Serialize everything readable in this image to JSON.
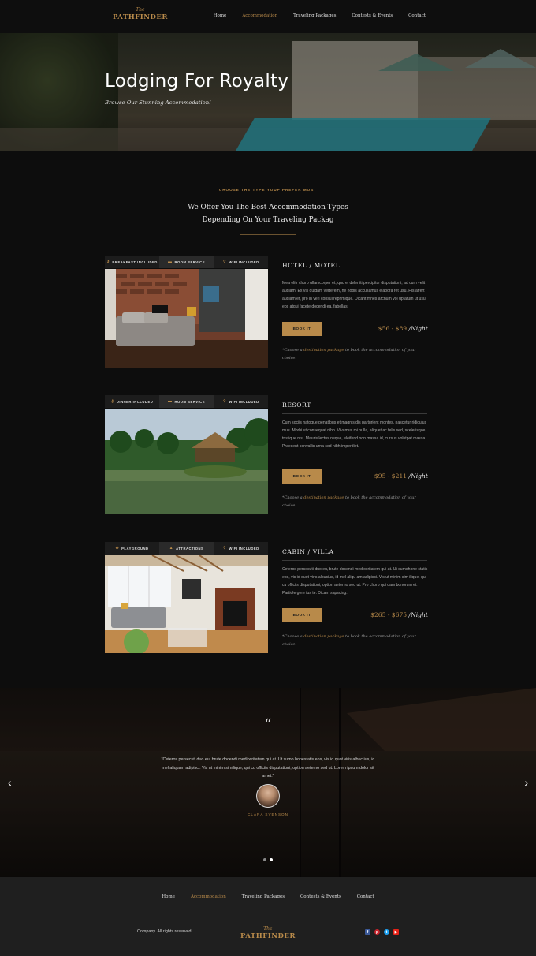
{
  "brand": {
    "the": "The",
    "name": "PATHFINDER"
  },
  "nav": {
    "items": [
      "Home",
      "Accommodation",
      "Traveling Packages",
      "Contests & Events",
      "Contact"
    ],
    "active": "Accommodation"
  },
  "hero": {
    "title": "Lodging For Royalty",
    "subtitle": "Browse Our Stunning Accommodation!"
  },
  "intro": {
    "eyebrow": "CHOOSE THE TYPE YOUP PREFER MOST",
    "title_line1": "We Offer You The Best Accommodation Types",
    "title_line2": "Depending On Your Traveling Packag"
  },
  "accommodations": [
    {
      "tags": [
        {
          "icon": "key-icon",
          "label": "BREAKFAST INCLUDED"
        },
        {
          "icon": "room-service-icon",
          "label": "ROOM SERVICE"
        },
        {
          "icon": "wifi-icon",
          "label": "WIFI INCLUDED"
        }
      ],
      "title": "HOTEL / MOTEL",
      "description": "Mea elitr choro ullamcorper et, quo ei deleniti percipitur disputationi, ad cum velit audiam. Ex vis quidam verterem, ne nobis accusamus elabora ret usu. His affert audiam et, pro in veri consul reprimique. Dicant mnes archum vol uptatum ut usu, eos atqui facete docendi ea, fabellas.",
      "book_label": "BOOK IT",
      "price": "$56 - $89",
      "price_unit": "Night",
      "note_pre": "*Choose a ",
      "note_link": "destination package",
      "note_post": " to book the accommodation of your choice."
    },
    {
      "tags": [
        {
          "icon": "key-icon",
          "label": "DINNER INCLUDED"
        },
        {
          "icon": "room-service-icon",
          "label": "ROOM SERVICE"
        },
        {
          "icon": "wifi-icon",
          "label": "WIFI INCLUDED"
        }
      ],
      "title": "RESORT",
      "description": "Cum sociis natoque penatibus et magnis dis parturient montes, nascetur ridiculus mus. Morbi ut consequat nibh. Vivamus mi nulla, aliquet ac felis sed, scelerisque tristique nisi. Mauris lectus neque, eleifend non massa id, cursus volutpat massa. Praesent convallis urna sed nibh imperdiet.",
      "book_label": "BOOK IT",
      "price": "$95 - $211",
      "price_unit": "Night",
      "note_pre": "*Choose a ",
      "note_link": "destination package",
      "note_post": " to book the accommodation of your choice."
    },
    {
      "tags": [
        {
          "icon": "playground-icon",
          "label": "PLAYGROUND"
        },
        {
          "icon": "attractions-icon",
          "label": "ATTRACTIONS"
        },
        {
          "icon": "wifi-icon",
          "label": "WIFI INCLUDED"
        }
      ],
      "title": "CABIN / VILLA",
      "description": "Ceteros persecuti duo eu, brute docendi mediocritatem qui at. Ut sumohone statis eos, vis id quot viris albucius, id mel aliqu am adipisci. Vis ut minim sim ilique, qui cu officiis disputationi, option aeterno sed ut. Pro choro qui dam bonorum ei. Partiole gere ius te. Dicam sapscing.",
      "book_label": "BOOK IT",
      "price": "$265 - $675",
      "price_unit": "Night",
      "note_pre": "*Choose a ",
      "note_link": "destination package",
      "note_post": " to book the accommodation of your choice."
    }
  ],
  "testimonial": {
    "quote_mark": "“",
    "quote": "\"Ceteros persecuti duo eu, brute docendi mediocritatem qui at. Ut sumo honestatis eos, vis id quot viris albuc ius, id mel aliquam adipisci. Vis ut minim similique, qui cu officiis disputationi, option aeterno sed ut. Lorem ipsum dolor sit amet.\"",
    "author": "CLARA SVENSON",
    "prev_icon": "chevron-left-icon",
    "next_icon": "chevron-right-icon",
    "slides": 2,
    "active_slide": 1
  },
  "footer": {
    "links": [
      "Home",
      "Accommodation",
      "Traveling Packages",
      "Contests & Events",
      "Contact"
    ],
    "active": "Accommodation",
    "copyright": "Company. All rights reserved.",
    "social": [
      {
        "icon": "facebook-icon",
        "glyph": "f",
        "color": "#3b5998"
      },
      {
        "icon": "pinterest-icon",
        "glyph": "p",
        "color": "#c8232c"
      },
      {
        "icon": "twitter-icon",
        "glyph": "t",
        "color": "#1da1f2"
      },
      {
        "icon": "youtube-icon",
        "glyph": "▶",
        "color": "#e62117"
      }
    ]
  },
  "colors": {
    "accent": "#b88a4a",
    "background": "#0d0d0d",
    "footer": "#1f1f1f"
  }
}
